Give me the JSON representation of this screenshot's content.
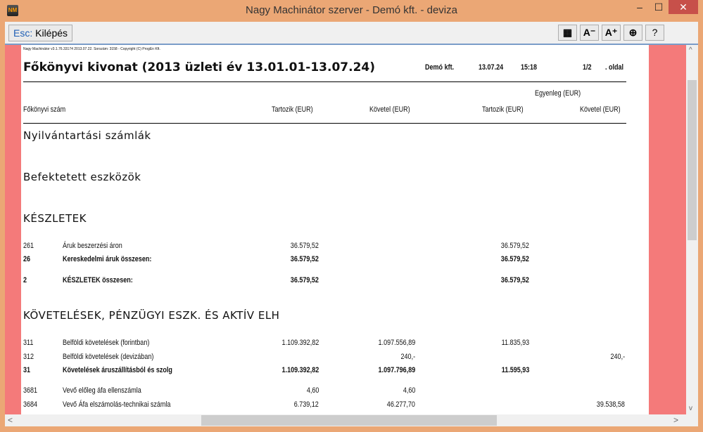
{
  "window": {
    "title": "Nagy Machinátor szerver - Demó kft. - deviza",
    "app_icon": "NM",
    "minimize": "–",
    "maximize": "☐",
    "close": "✕"
  },
  "toolbar": {
    "esc_key": "Esc:",
    "esc_label": " Kilépés",
    "buttons": [
      {
        "icon": "grid-icon",
        "label": "▦"
      },
      {
        "icon": "font-decrease-icon",
        "label": "A⁻"
      },
      {
        "icon": "font-increase-icon",
        "label": "A⁺"
      },
      {
        "icon": "navigate-icon",
        "label": "⊕"
      },
      {
        "icon": "help-icon",
        "label": "?"
      }
    ]
  },
  "report": {
    "copyright": "Nagy Machinátor v3.1.76.33174 2013.07.22. Sorszám: 3158 - Copyright (C) ProgEn Kft.",
    "title": "Főkönyvi kivonat (2013 üzleti év 13.01.01-13.07.24)",
    "company": "Demó kft.",
    "date": "13.07.24",
    "time": "15:18",
    "page": "1/2",
    "page_suffix": ". oldal",
    "headers": {
      "account": "Főkönyvi szám",
      "debit": "Tartozik (EUR)",
      "credit": "Követel (EUR)",
      "balance": "Egyenleg (EUR)",
      "bal_debit": "Tartozik (EUR)",
      "bal_credit": "Követel (EUR)"
    },
    "sections": [
      "Nyilvántartási számlák",
      "Befektetett eszközök",
      "KÉSZLETEK",
      "KÖVETELÉSEK, PÉNZÜGYI ESZK. ÉS AKTÍV ELH"
    ],
    "rows": [
      {
        "code": "261",
        "name": "Áruk beszerzési áron",
        "debit": "36.579,52",
        "credit": "",
        "bal_debit": "36.579,52",
        "bal_credit": ""
      },
      {
        "code": "26",
        "name": "Kereskedelmi áruk összesen:",
        "debit": "36.579,52",
        "credit": "",
        "bal_debit": "36.579,52",
        "bal_credit": ""
      },
      {
        "code": "2",
        "name": "KÉSZLETEK összesen:",
        "debit": "36.579,52",
        "credit": "",
        "bal_debit": "36.579,52",
        "bal_credit": ""
      },
      {
        "code": "311",
        "name": "Belföldi követelések (forintban)",
        "debit": "1.109.392,82",
        "credit": "1.097.556,89",
        "bal_debit": "11.835,93",
        "bal_credit": ""
      },
      {
        "code": "312",
        "name": "Belföldi követelések (devizában)",
        "debit": "",
        "credit": "240,-",
        "bal_debit": "",
        "bal_credit": "240,-"
      },
      {
        "code": "31",
        "name": "Követelések áruszállításból és szolg",
        "debit": "1.109.392,82",
        "credit": "1.097.796,89",
        "bal_debit": "11.595,93",
        "bal_credit": ""
      },
      {
        "code": "3681",
        "name": "Vevő előleg áfa ellenszámla",
        "debit": "4,60",
        "credit": "4,60",
        "bal_debit": "",
        "bal_credit": ""
      },
      {
        "code": "3684",
        "name": "Vevő Áfa elszámolás-technikai számla",
        "debit": "6.739,12",
        "credit": "46.277,70",
        "bal_debit": "",
        "bal_credit": "39.538,58"
      }
    ]
  },
  "scroll": {
    "up": "^",
    "down": "v",
    "left": "<",
    "right": ">"
  }
}
